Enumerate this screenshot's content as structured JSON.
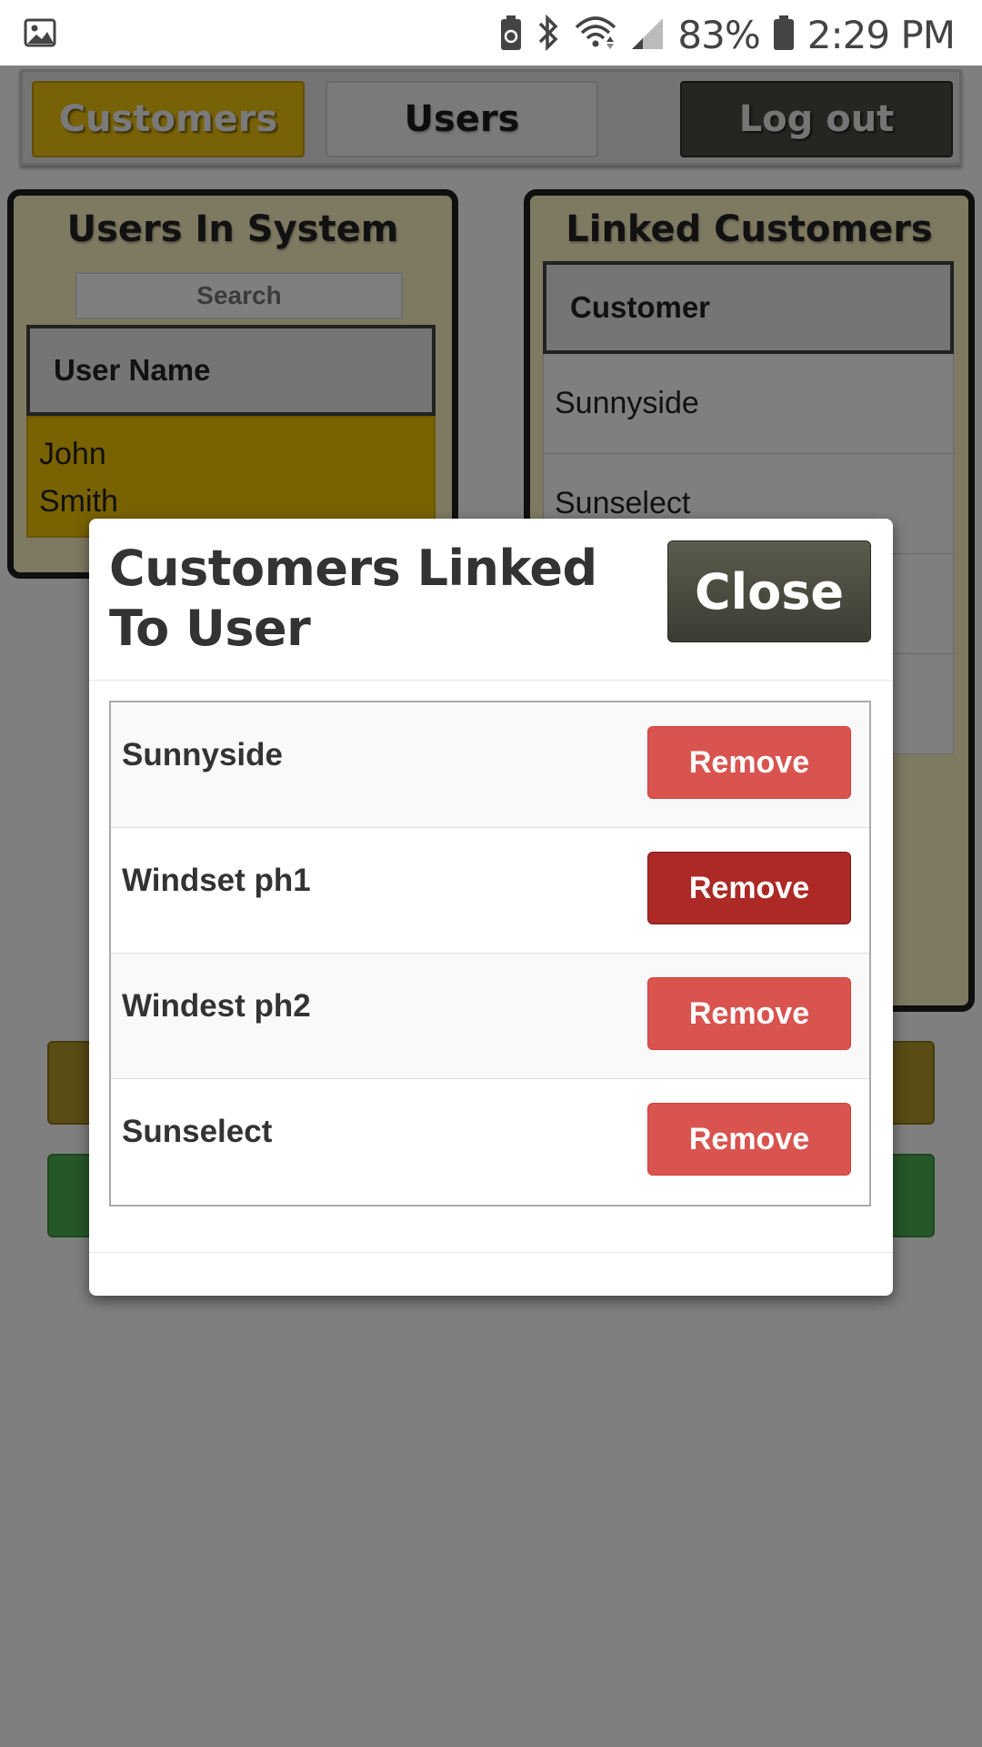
{
  "status_bar": {
    "battery_percent": "83%",
    "time": "2:29 PM",
    "icons": [
      "image-icon",
      "battery-saver-icon",
      "bluetooth-icon",
      "wifi-icon",
      "signal-icon",
      "battery-icon"
    ]
  },
  "nav": {
    "customers_label": "Customers",
    "users_label": "Users",
    "logout_label": "Log out"
  },
  "users_panel": {
    "title": "Users In System",
    "search_placeholder": "Search",
    "column_header": "User Name",
    "rows": [
      {
        "line1": "John",
        "line2": "Smith"
      }
    ]
  },
  "linked_panel": {
    "title": "Linked Customers",
    "column_header": "Customer",
    "rows": [
      "Sunnyside",
      "Sunselect",
      "",
      ""
    ]
  },
  "modal": {
    "title": "Customers Linked To User",
    "close_label": "Close",
    "remove_label": "Remove",
    "rows": [
      {
        "name": "Sunnyside"
      },
      {
        "name": "Windset ph1"
      },
      {
        "name": "Windest ph2"
      },
      {
        "name": "Sunselect"
      }
    ]
  },
  "colors": {
    "accent_yellow": "#f1c40f",
    "danger": "#d9534f",
    "danger_active": "#ac2925",
    "close_button": "#4a4a3f",
    "success_green": "#4caf50"
  }
}
